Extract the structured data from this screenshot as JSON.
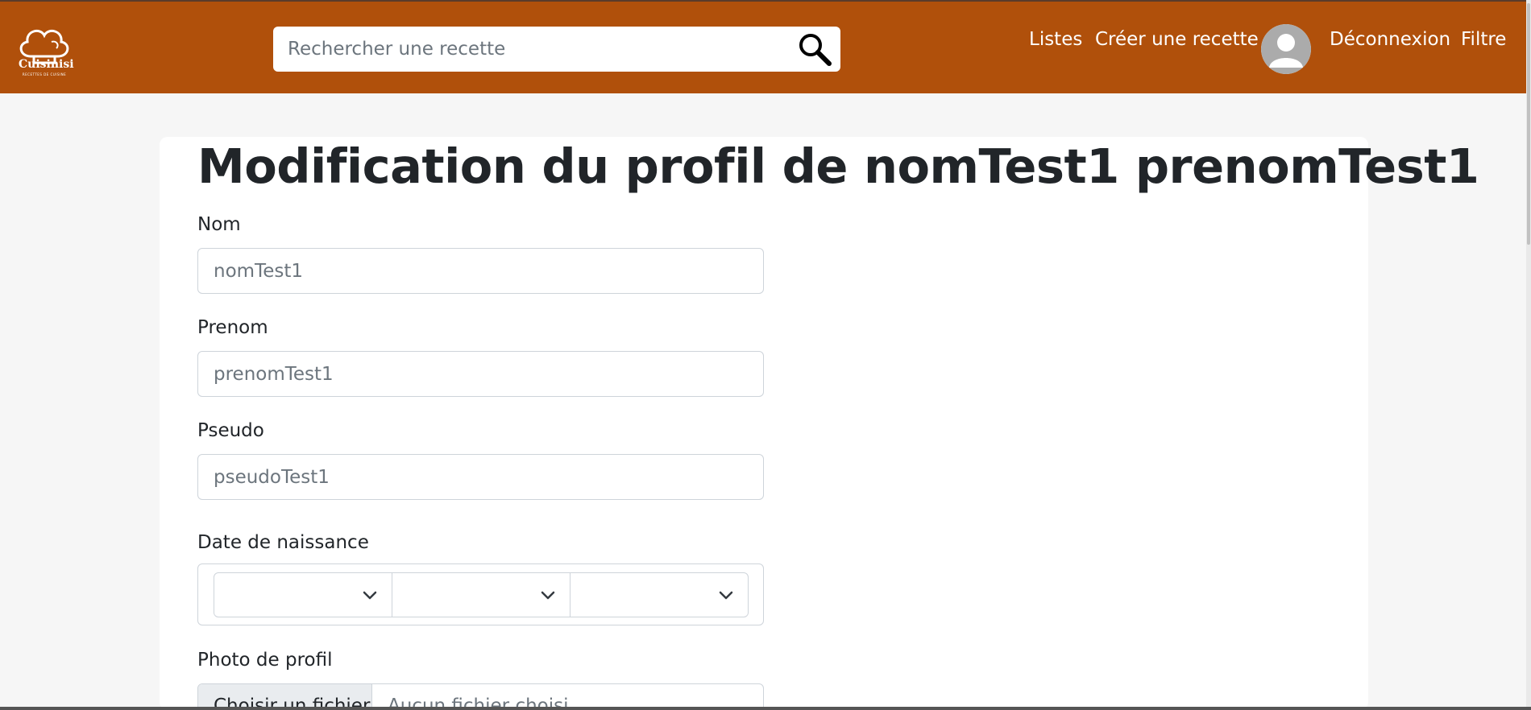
{
  "header": {
    "logo": {
      "brand": "Cuisinisi",
      "tagline": "RECETTES DE CUISINE",
      "icon": "chef-hat-icon"
    },
    "search": {
      "placeholder": "Rechercher une recette",
      "value": "",
      "icon": "search-icon"
    },
    "nav": {
      "listes": "Listes",
      "create_recipe": "Créer une recette",
      "avatar_icon": "user-avatar-icon",
      "logout": "Déconnexion",
      "filter": "Filtre"
    }
  },
  "form": {
    "title": "Modification du profil de nomTest1 prenomTest1",
    "nom": {
      "label": "Nom",
      "placeholder": "nomTest1"
    },
    "prenom": {
      "label": "Prenom",
      "placeholder": "prenomTest1"
    },
    "pseudo": {
      "label": "Pseudo",
      "placeholder": "pseudoTest1"
    },
    "birthdate": {
      "label": "Date de naissance",
      "day": "",
      "month": "",
      "year": ""
    },
    "photo": {
      "label": "Photo de profil",
      "button": "Choisir un fichier",
      "filename": "Aucun fichier choisi"
    }
  },
  "colors": {
    "navbar": "#b0500b",
    "page_background": "#f6f6f6",
    "card": "#ffffff",
    "text": "#212529",
    "placeholder": "#6c757d"
  }
}
